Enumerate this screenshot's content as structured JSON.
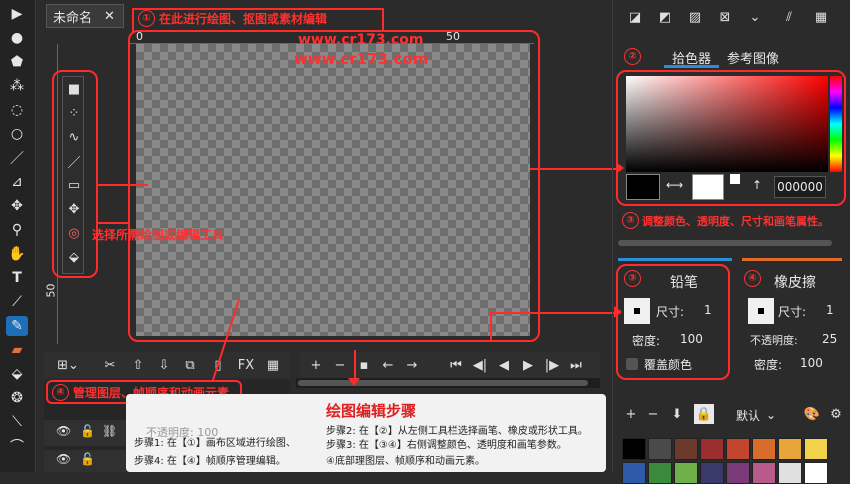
{
  "doc_tab": {
    "title": "未命名",
    "close": "✕"
  },
  "ruler": {
    "top_0": "0",
    "top_50": "50",
    "left_50": "50"
  },
  "watermark": [
    "www.cr173.com",
    "www.cr173.com"
  ],
  "annotations": {
    "canvas": {
      "num": "①",
      "text": "在此进行绘图、抠图或素材编辑"
    },
    "tools": "选择所需绘图或编辑工具",
    "color": {
      "num": "③",
      "text": "调整颜色、透明度、尺寸和画笔属性。"
    },
    "layers": {
      "num": "④",
      "text": "管理图层、帧顺序和动画元素"
    },
    "panel2": {
      "num": "②"
    },
    "pencil_num": "③",
    "eraser_num": "④"
  },
  "top_right_icons": [
    "◪",
    "◩",
    "▨",
    "⊠",
    "⌄",
    "⫽",
    "▦"
  ],
  "color_tabs": [
    "拾色器",
    "参考图像"
  ],
  "color_hex": "000000",
  "pencil": {
    "title": "铅笔",
    "size_label": "尺寸:",
    "size_value": "1",
    "density_label": "密度:",
    "density_value": "100",
    "cover_label": "覆盖颜色"
  },
  "eraser": {
    "title": "橡皮擦",
    "size_label": "尺寸:",
    "size_value": "1",
    "opacity_label": "不透明度:",
    "opacity_value": "25",
    "density_label": "密度:",
    "density_value": "100"
  },
  "default_dropdown": "默认",
  "layer_opacity": "不透明度: 100",
  "steps": {
    "title": "绘图编辑步骤",
    "s1": "步骤1: 在【①】画布区域进行绘图、",
    "s2": "步骤2: 在【②】从左侧工具栏选择画笔、橡皮或形状工具。",
    "s3": "步骤3: 在【③④】右侧调整颜色、透明度和画笔参数。",
    "s4": "步骤4: 在【④】帧顺序管理编辑。",
    "s5": "④底部理图层、帧顺序和动画元素。"
  },
  "palette": [
    "#000000",
    "#4a4a4a",
    "#6b3a2a",
    "#9b2f2f",
    "#c2452e",
    "#d96c2c",
    "#e8a63a",
    "#f2d24a",
    "#2e5aa8",
    "#3c8a3c",
    "#6fb04a",
    "#3a3a6a",
    "#7a3a7a",
    "#b85a8a",
    "#e0e0e0",
    "#ffffff"
  ],
  "colors": {
    "accent_red": "#ff2a2a",
    "tab_blue": "#2a8fd8",
    "eraser_orange": "#e06a2a"
  }
}
